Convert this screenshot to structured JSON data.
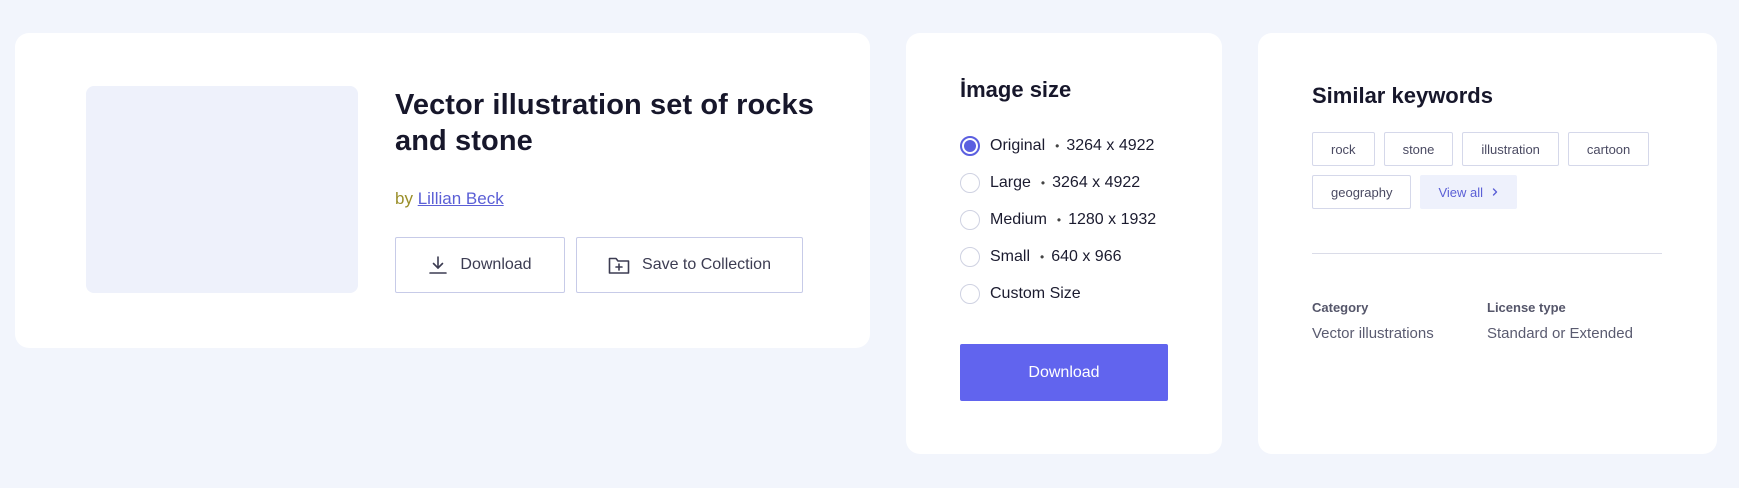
{
  "detail": {
    "title": "Vector illustration set of rocks and stone",
    "by_prefix": "by",
    "author": "Lillian Beck",
    "download_label": "Download",
    "save_label": "Save to Collection"
  },
  "image_size": {
    "heading": "İmage size",
    "selected": "Original",
    "options": [
      {
        "label": "Original",
        "dimensions": "3264 x 4922",
        "checked": true
      },
      {
        "label": "Large",
        "dimensions": "3264 x 4922",
        "checked": false
      },
      {
        "label": "Medium",
        "dimensions": "1280 x 1932",
        "checked": false
      },
      {
        "label": "Small",
        "dimensions": "640 x 966",
        "checked": false
      },
      {
        "label": "Custom Size",
        "dimensions": "",
        "checked": false
      }
    ],
    "download_label": "Download"
  },
  "keywords": {
    "heading": "Similar keywords",
    "tags": [
      "rock",
      "stone",
      "illustration",
      "cartoon",
      "geography"
    ],
    "view_all_label": "View all",
    "category_label": "Category",
    "category_value": "Vector illustrations",
    "license_label": "License type",
    "license_value": "Standard or Extended"
  },
  "colors": {
    "accent": "#6164ee",
    "background": "#f2f5fc",
    "card": "#ffffff",
    "link": "#5b5fd6"
  }
}
